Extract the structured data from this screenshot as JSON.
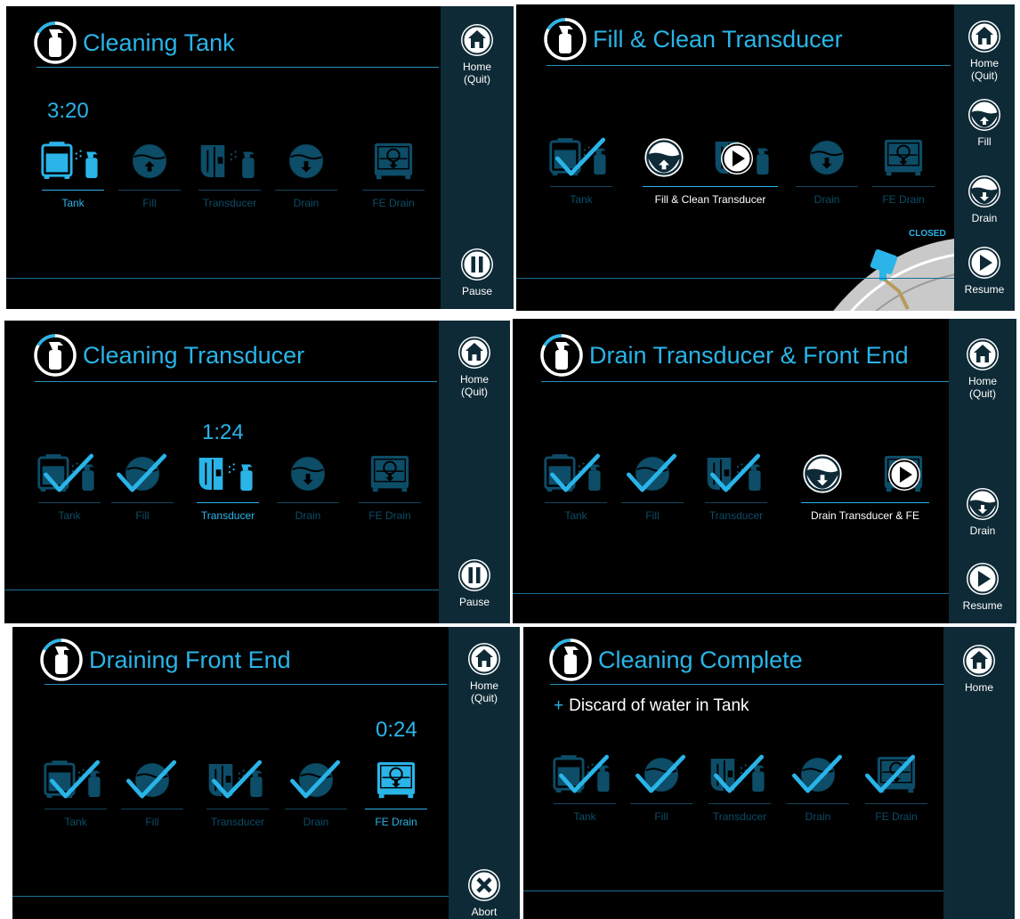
{
  "colors": {
    "accent": "#2ab4e8",
    "dim": "#0d4d68",
    "sidebar": "#0e2a36",
    "background": "#000000"
  },
  "step_labels": {
    "tank": "Tank",
    "fill": "Fill",
    "transducer": "Transducer",
    "drain": "Drain",
    "fe_drain": "FE Drain"
  },
  "panels": {
    "p1": {
      "title": "Cleaning Tank",
      "timer": "3:20",
      "home": "Home",
      "quit": "(Quit)",
      "pause": "Pause"
    },
    "p2": {
      "title": "Fill & Clean Transducer",
      "merged_label": "Fill & Clean Transducer",
      "home": "Home",
      "quit": "(Quit)",
      "fill": "Fill",
      "drain": "Drain",
      "resume": "Resume",
      "valve_status": "CLOSED"
    },
    "p3": {
      "title": "Cleaning Transducer",
      "timer": "1:24",
      "home": "Home",
      "quit": "(Quit)",
      "pause": "Pause"
    },
    "p4": {
      "title": "Drain Transducer & Front End",
      "merged_label": "Drain Transducer & FE",
      "home": "Home",
      "quit": "(Quit)",
      "drain": "Drain",
      "resume": "Resume"
    },
    "p5": {
      "title": "Draining Front End",
      "timer": "0:24",
      "home": "Home",
      "quit": "(Quit)",
      "abort": "Abort"
    },
    "p6": {
      "title": "Cleaning Complete",
      "note": "Discard of water in Tank",
      "note_prefix": "+",
      "home": "Home"
    }
  },
  "icons": [
    "spray-bottle-icon",
    "tank-icon",
    "fill-icon",
    "transducer-icon",
    "drain-icon",
    "fe-drain-icon",
    "checkmark-icon",
    "home-icon",
    "pause-icon",
    "play-icon",
    "resume-icon",
    "abort-icon",
    "valve-icon"
  ]
}
